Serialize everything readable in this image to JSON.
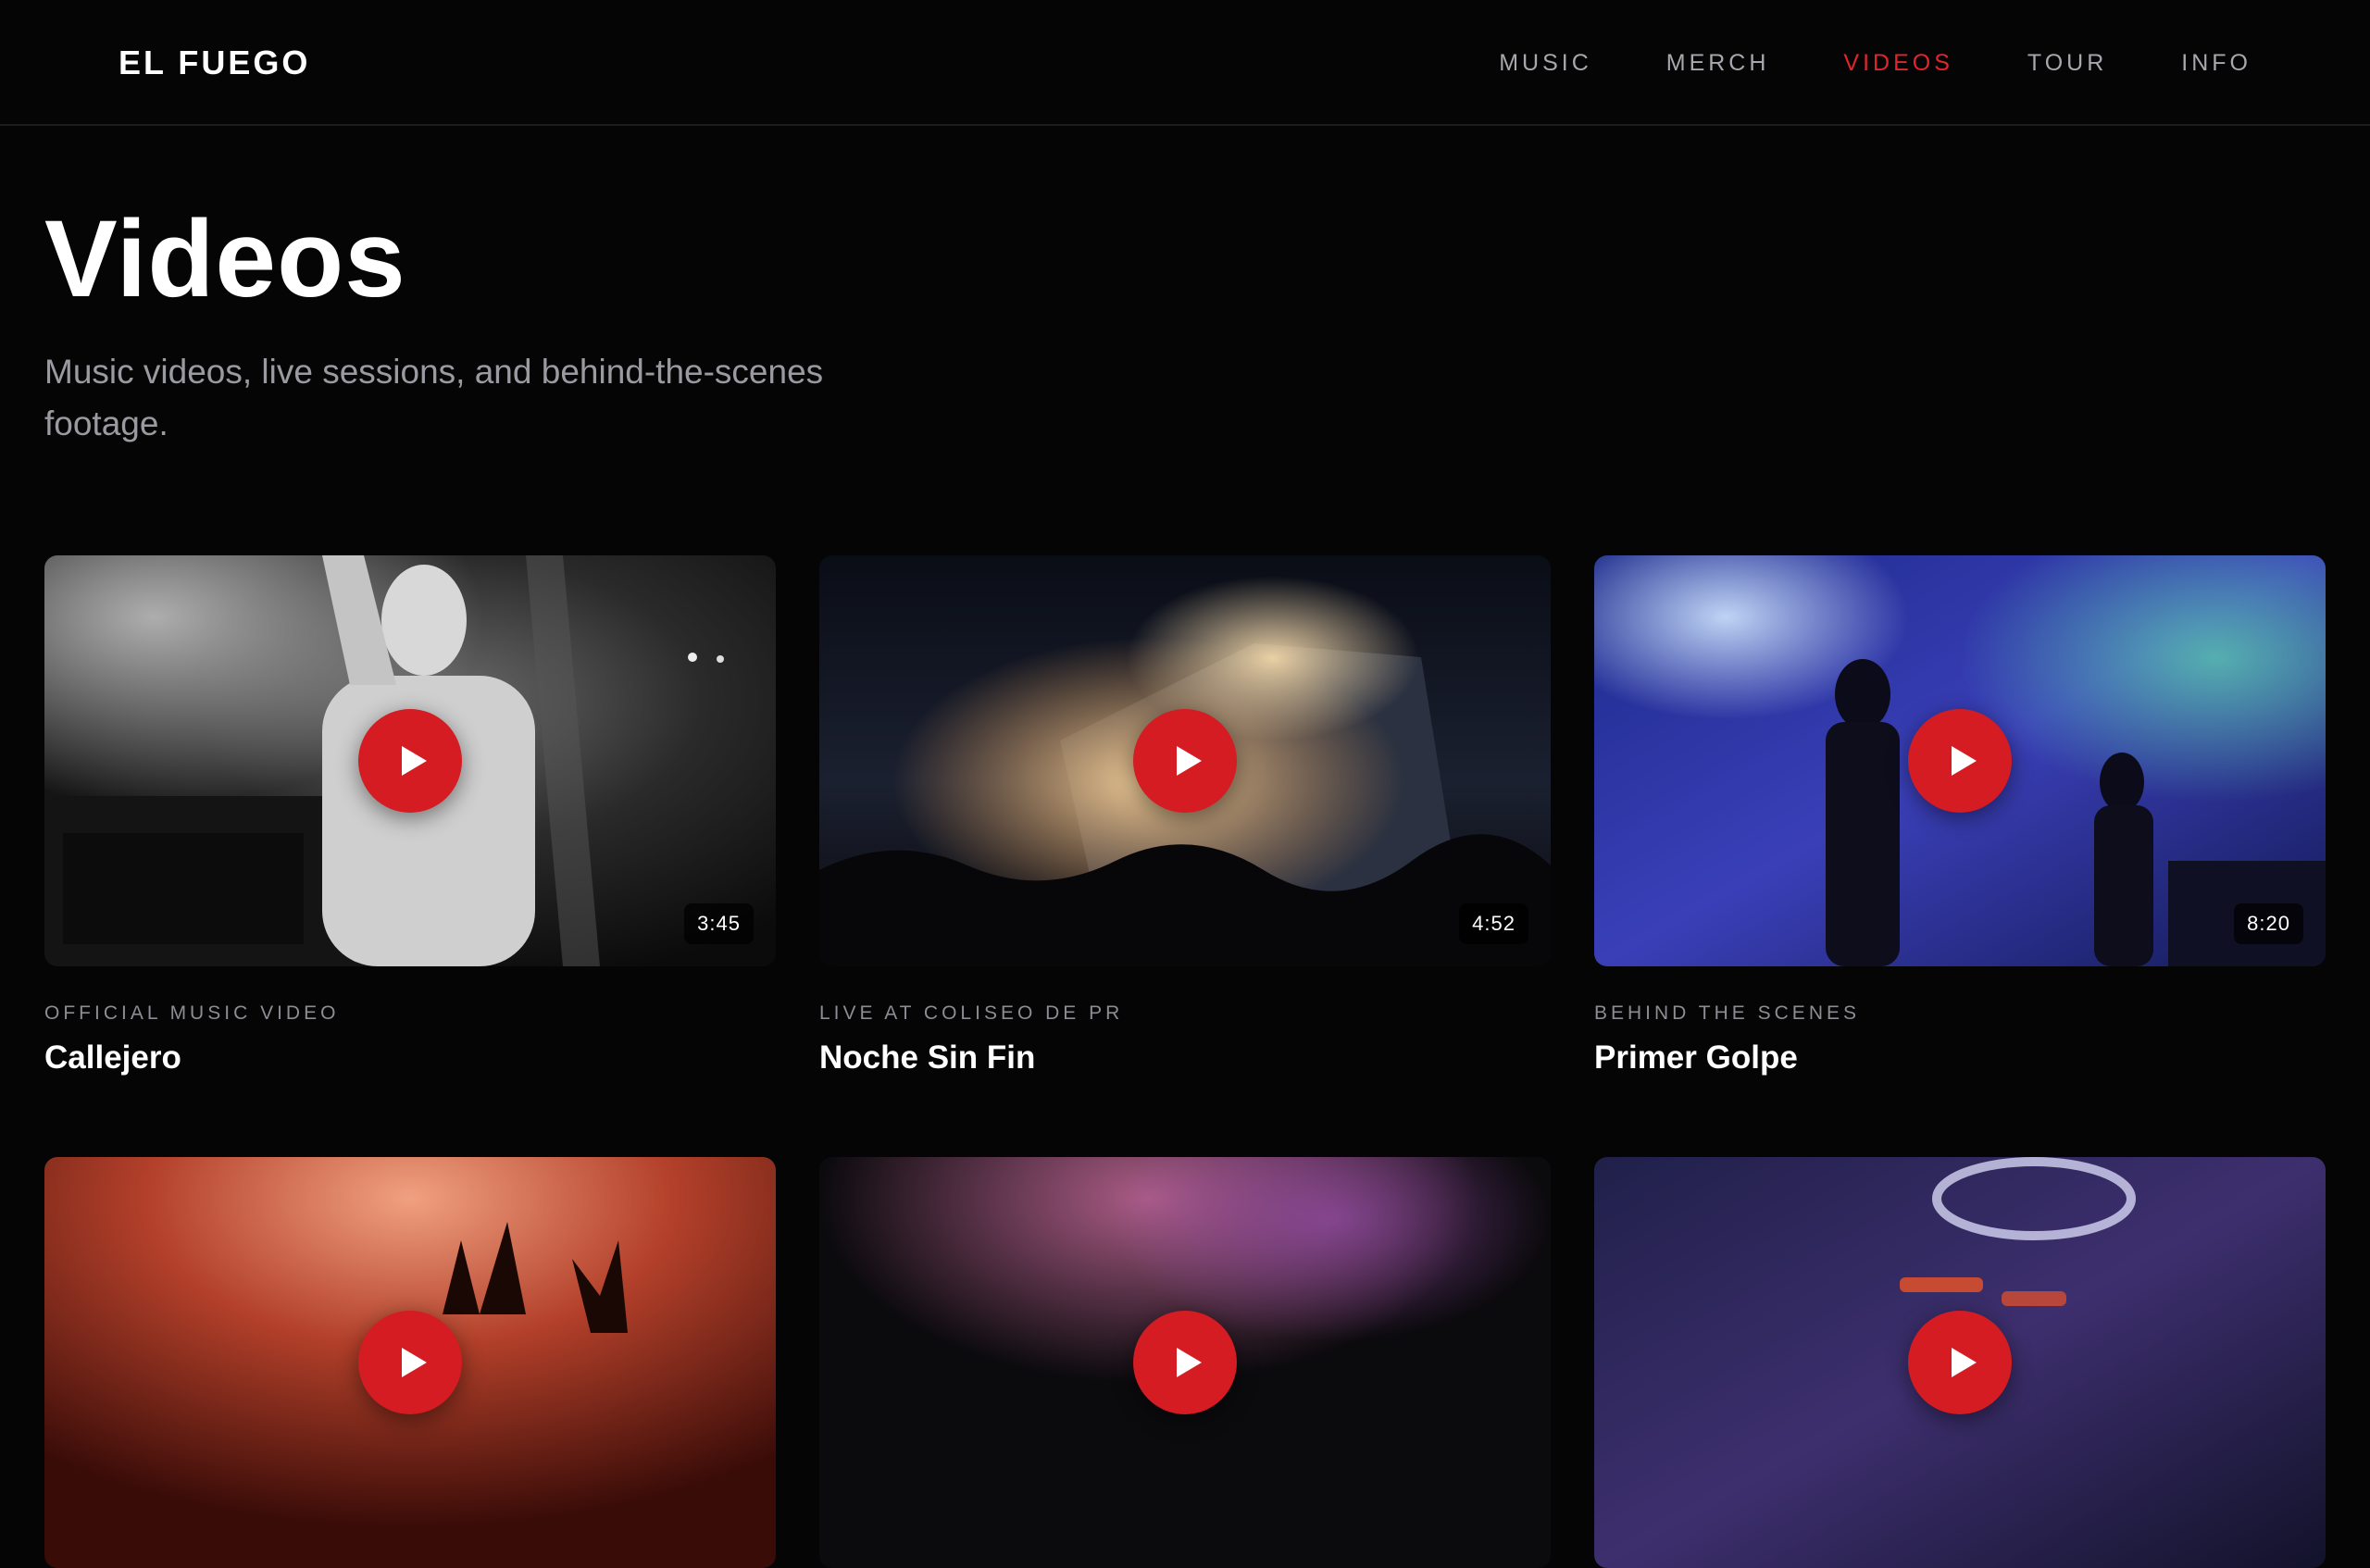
{
  "header": {
    "logo": "EL FUEGO",
    "nav": [
      {
        "label": "MUSIC"
      },
      {
        "label": "MERCH"
      },
      {
        "label": "VIDEOS",
        "active": true
      },
      {
        "label": "TOUR"
      },
      {
        "label": "INFO"
      }
    ]
  },
  "hero": {
    "title": "Videos",
    "subtitle": "Music videos, live sessions, and behind-the-scenes footage."
  },
  "videos": [
    {
      "category": "OFFICIAL MUSIC VIDEO",
      "title": "Callejero",
      "duration": "3:45"
    },
    {
      "category": "LIVE AT COLISEO DE PR",
      "title": "Noche Sin Fin",
      "duration": "4:52"
    },
    {
      "category": "BEHIND THE SCENES",
      "title": "Primer Golpe",
      "duration": "8:20"
    },
    {},
    {},
    {}
  ],
  "icons": {
    "play": "play-icon"
  },
  "colors": {
    "accent": "#e0262a",
    "play_button": "#d41c22",
    "background": "#050506",
    "nav_text": "#a7a7ad",
    "muted_text": "#8c8c93"
  }
}
